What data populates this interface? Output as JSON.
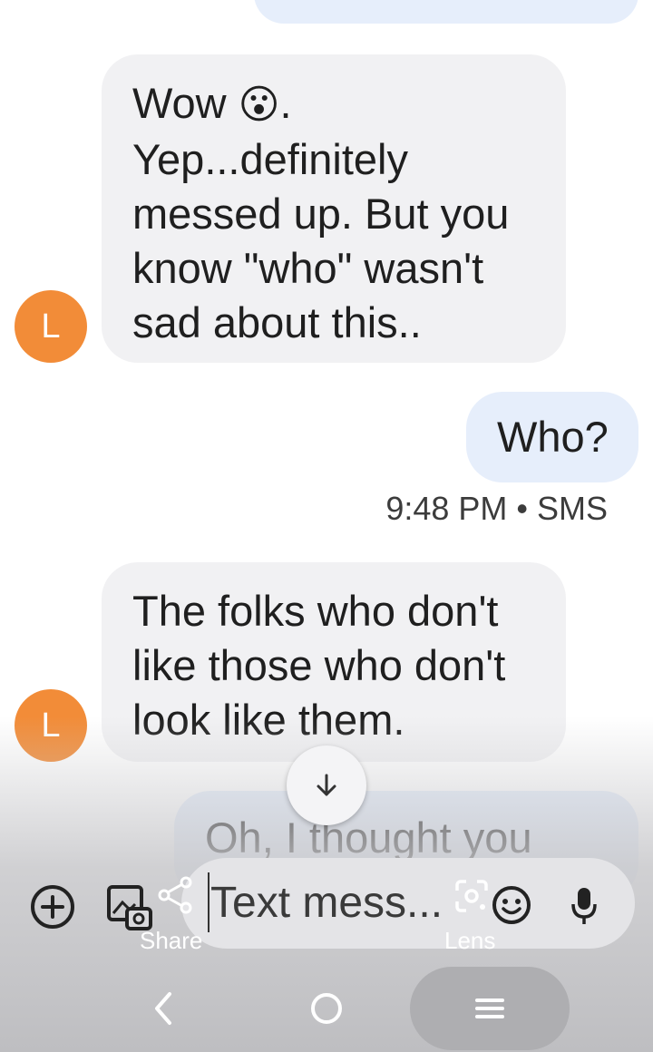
{
  "messages": {
    "top_partial_out": "",
    "msg1": {
      "avatar_initial": "L",
      "lines": [
        "Wow",
        "Yep...definitely",
        "messed up. But you",
        "know \"who\" wasn't",
        "sad about this.."
      ],
      "emoji": "😮",
      "after_emoji": "."
    },
    "msg2": {
      "text": "Who?"
    },
    "msg2_meta": "9:48 PM • SMS",
    "msg3": {
      "avatar_initial": "L",
      "lines": [
        "The folks who don't",
        "like those who don't",
        "look like them."
      ]
    },
    "msg4_partial": "Oh, I thought you"
  },
  "composer": {
    "placeholder": "Text mess...",
    "share_label": "Share",
    "lens_label": "Lens"
  },
  "icons": {
    "add": "add-circle-icon",
    "gallery": "gallery-camera-icon",
    "share": "share-icon",
    "lens": "lens-icon",
    "emoji": "emoji-icon",
    "mic": "mic-icon",
    "scroll_down": "arrow-down-icon",
    "back": "back-icon",
    "home": "home-icon",
    "menu": "menu-icon"
  },
  "colors": {
    "incoming_bubble": "#f1f1f3",
    "outgoing_bubble": "#e6eefb",
    "avatar": "#f28c38"
  }
}
